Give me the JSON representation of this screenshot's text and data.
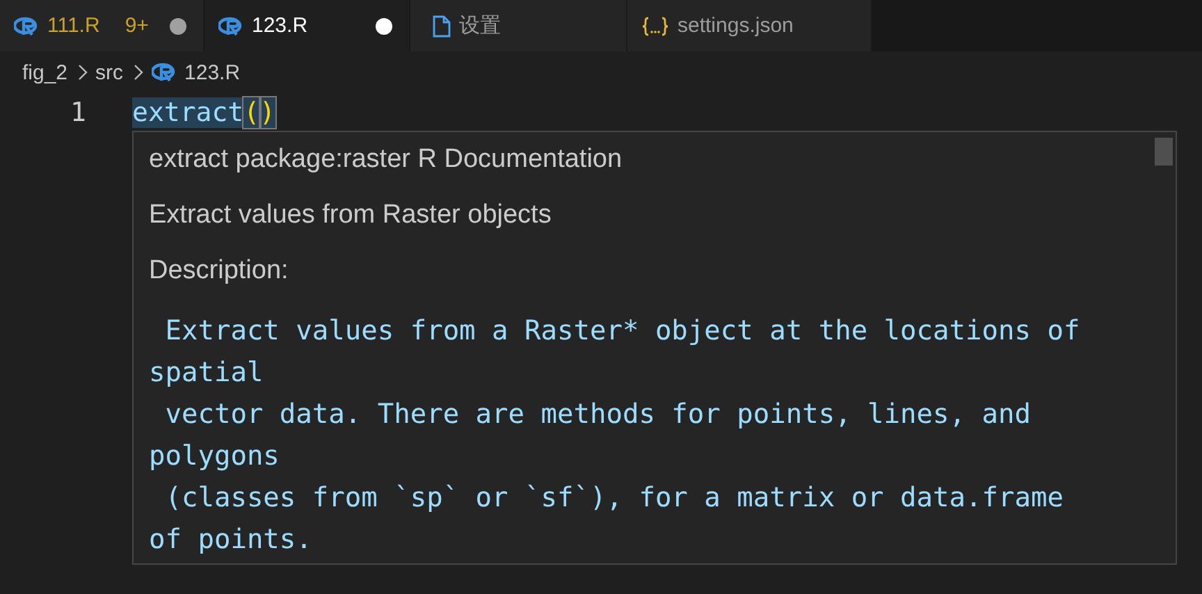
{
  "tabs": [
    {
      "label": "111.R",
      "kind": "r",
      "selected": false,
      "modified": true,
      "problems": "9+",
      "warning": true
    },
    {
      "label": "123.R",
      "kind": "r",
      "selected": true,
      "modified": true,
      "warning": false
    },
    {
      "label": "设置",
      "kind": "file",
      "selected": false,
      "modified": false,
      "warning": false
    },
    {
      "label": "settings.json",
      "kind": "json",
      "selected": false,
      "modified": false,
      "warning": false
    }
  ],
  "breadcrumb": [
    {
      "label": "fig_2",
      "kind": "folder"
    },
    {
      "label": "src",
      "kind": "folder"
    },
    {
      "label": "123.R",
      "kind": "r"
    }
  ],
  "editor": {
    "lines": [
      {
        "number": "1",
        "name": "extract",
        "open": "(",
        "close": ")"
      }
    ]
  },
  "hover": {
    "title": "extract package:raster R Documentation",
    "summary": "Extract values from Raster objects",
    "heading": "Description:",
    "description": " Extract values from a Raster* object at the locations of\nspatial\n vector data. There are methods for points, lines, and\npolygons\n (classes from `sp` or `sf`), for a matrix or data.frame\nof points."
  }
}
